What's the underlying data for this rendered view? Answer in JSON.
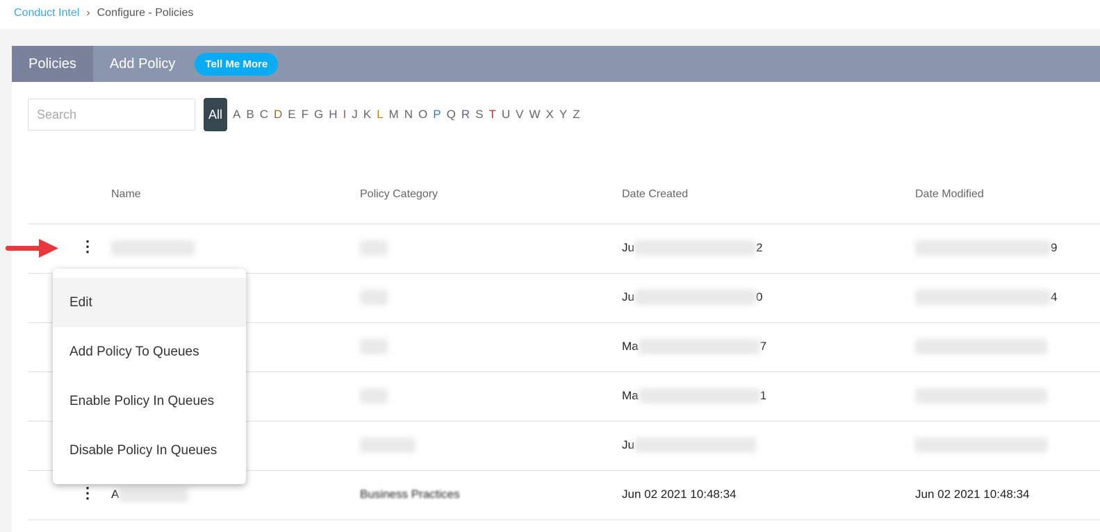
{
  "breadcrumb": {
    "root": "Conduct Intel",
    "current": "Configure - Policies"
  },
  "tabs": [
    {
      "label": "Policies",
      "active": true
    },
    {
      "label": "Add Policy"
    }
  ],
  "tell_me_more": "Tell Me More",
  "search": {
    "placeholder": "Search",
    "value": ""
  },
  "alphabet": {
    "all": "All",
    "letters": [
      "A",
      "B",
      "C",
      "D",
      "E",
      "F",
      "G",
      "H",
      "I",
      "J",
      "K",
      "L",
      "M",
      "N",
      "O",
      "P",
      "Q",
      "R",
      "S",
      "T",
      "U",
      "V",
      "W",
      "X",
      "Y",
      "Z"
    ]
  },
  "columns": [
    "Name",
    "Policy Category",
    "Date Created",
    "Date Modified"
  ],
  "rows": [
    {
      "name": "",
      "category": "",
      "created_prefix": "Ju",
      "created_suffix": "2",
      "modified_prefix": "",
      "modified_suffix": "9"
    },
    {
      "name": "",
      "category": "",
      "created_prefix": "Ju",
      "created_suffix": "0",
      "modified_prefix": "",
      "modified_suffix": "4"
    },
    {
      "name": "",
      "category": "",
      "created_prefix": "Ma",
      "created_suffix": "7",
      "modified_prefix": "",
      "modified_suffix": ""
    },
    {
      "name": "",
      "category": "",
      "created_prefix": "Ma",
      "created_suffix": "1",
      "modified_prefix": "",
      "modified_suffix": ""
    },
    {
      "name": "",
      "category": "",
      "created_prefix": "Ju",
      "created_suffix": "",
      "modified_prefix": "",
      "modified_suffix": ""
    },
    {
      "name": "A",
      "category": "Business Practices",
      "created_prefix": "Jun 02 2021 10:48:34",
      "created_suffix": "",
      "modified_prefix": "Jun 02 2021 10:48:34",
      "modified_suffix": ""
    }
  ],
  "context_menu": {
    "items": [
      "Edit",
      "Add Policy To Queues",
      "Enable Policy In Queues",
      "Disable Policy In Queues"
    ],
    "highlighted": "Edit"
  },
  "colors": {
    "header_bar": "#8a96ae",
    "active_tab": "#7a829b",
    "tell_me_more": "#0aabf5",
    "all_button": "#37474f",
    "annotation_arrow": "#e8383d",
    "link": "#3ea6e8"
  }
}
